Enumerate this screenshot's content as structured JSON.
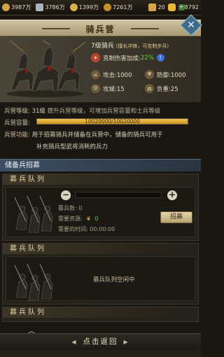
{
  "resources": [
    {
      "icon": "crown-gold-icon",
      "value": "3987万",
      "color": "#d3a64b"
    },
    {
      "icon": "iron-ingot-icon",
      "value": "3786万",
      "color": "#a9b3bd"
    },
    {
      "icon": "wheat-icon",
      "value": "1399万",
      "color": "#d4b24a"
    },
    {
      "icon": "coin-icon",
      "value": "7261万",
      "color": "#c98c2a"
    }
  ],
  "premium": [
    {
      "icon": "scroll-icon",
      "value": "20",
      "color": "#d6a54a"
    },
    {
      "icon": "gold-ingot-icon",
      "value": "8792",
      "color": "#e7b83a"
    }
  ],
  "header": {
    "title": "骑兵营"
  },
  "unit": {
    "title": "7级骑兵",
    "subtitle": "(擅长冲锋，可克制步兵)",
    "counter_label": "克制伤害加成:",
    "counter_value": "22%",
    "attack": "攻击:1000",
    "defense": "防御:1000",
    "siege": "攻城:15",
    "load": "负重:25"
  },
  "barracks": {
    "level_label": "兵营等级:",
    "level_value": "31级",
    "level_hint": "提升兵营等级，可增加兵营容量和士兵等级",
    "capacity_label": "兵营容量:",
    "capacity_text": "10020000/10020000",
    "capacity_fraction": 1.0,
    "function_label": "兵营功能:",
    "function_line1": "用于招募骑兵并储备在兵营中，储备的骑兵可用于",
    "function_line2": "补充骑兵型武将消耗的兵力"
  },
  "recruit": {
    "section_title": "储备兵招募",
    "queues": [
      {
        "title": "募兵队列",
        "count_label": "募兵数:",
        "count_value": "0",
        "resource_label": "需要资源:",
        "resource_value": "0",
        "time_label": "需要的时间:",
        "time_value": "00:00:00",
        "recruit_button": "招募"
      },
      {
        "title": "募兵队列",
        "status": "募兵队列空闲中"
      },
      {
        "title": "募兵队列"
      }
    ]
  },
  "footer": {
    "back_label": "点击返回"
  }
}
